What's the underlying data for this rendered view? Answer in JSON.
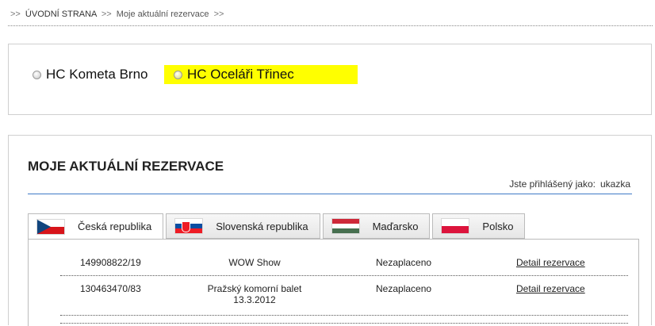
{
  "breadcrumb": {
    "sep": ">>",
    "home": "ÚVODNÍ STRANA",
    "current": "Moje aktuální rezervace"
  },
  "teams": [
    {
      "label": "HC Kometa Brno",
      "selected": false,
      "highlight": false
    },
    {
      "label": "HC Oceláři Třinec",
      "selected": false,
      "highlight": true,
      "highlight_color": "#ffff00"
    }
  ],
  "reservations": {
    "title": "MOJE AKTUÁLNÍ REZERVACE",
    "logged_label": "Jste přihlášený jako:",
    "logged_user": "ukazka",
    "rule_color": "#3f79c7",
    "tabs": [
      {
        "label": "Česká republika",
        "flag": "flag-cz-icon",
        "active": true
      },
      {
        "label": "Slovenská republika",
        "flag": "flag-sk-icon",
        "active": false
      },
      {
        "label": "Maďarsko",
        "flag": "flag-hu-icon",
        "active": false
      },
      {
        "label": "Polsko",
        "flag": "flag-pl-icon",
        "active": false
      }
    ],
    "rows": [
      {
        "id": "149908822/19",
        "event": "WOW Show",
        "event_date": "",
        "status": "Nezaplaceno",
        "link": "Detail rezervace"
      },
      {
        "id": "130463470/83",
        "event": "Pražský komorní balet",
        "event_date": "13.3.2012",
        "status": "Nezaplaceno",
        "link": "Detail rezervace"
      }
    ]
  }
}
